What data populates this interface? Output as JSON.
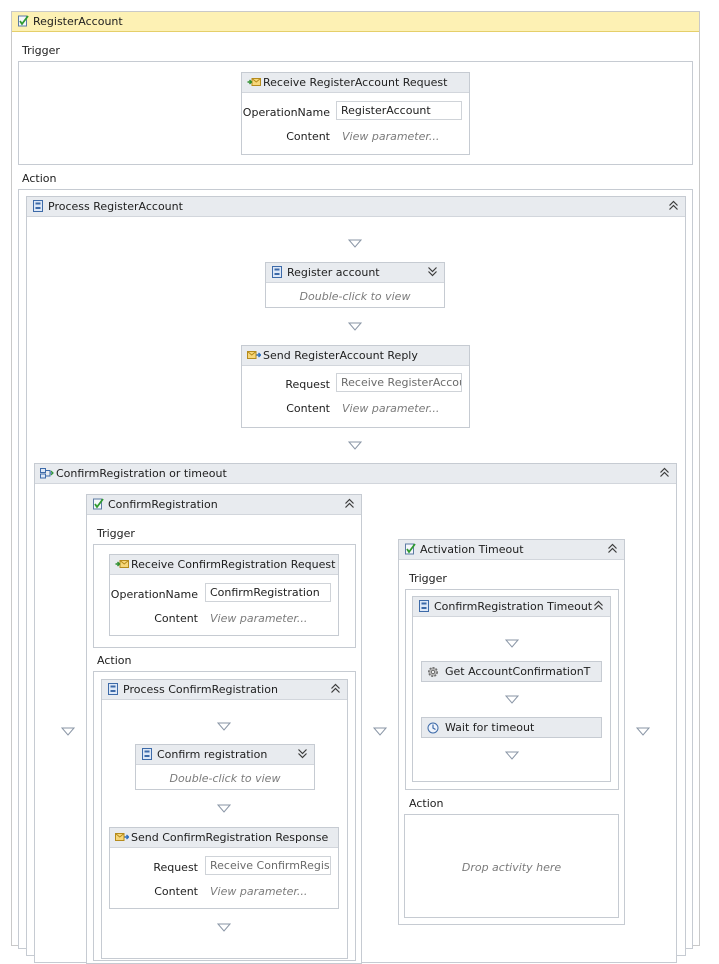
{
  "workflow": {
    "title": "RegisterAccount",
    "trigger_label": "Trigger",
    "action_label": "Action",
    "receive": {
      "title": "Receive RegisterAccount Request",
      "operation_label": "OperationName",
      "operation_value": "RegisterAccount",
      "content_label": "Content",
      "content_value": "View parameter..."
    },
    "process": {
      "title": "Process RegisterAccount",
      "register": {
        "title": "Register account",
        "body": "Double-click to view"
      },
      "send_reply": {
        "title": "Send RegisterAccount Reply",
        "request_label": "Request",
        "request_value": "Receive RegisterAccount",
        "content_label": "Content",
        "content_value": "View parameter..."
      },
      "pick": {
        "title": "ConfirmRegistration or timeout",
        "confirm_branch": {
          "title": "ConfirmRegistration",
          "trigger_label": "Trigger",
          "action_label": "Action",
          "receive": {
            "title": "Receive ConfirmRegistration Request",
            "operation_label": "OperationName",
            "operation_value": "ConfirmRegistration",
            "content_label": "Content",
            "content_value": "View parameter..."
          },
          "process": {
            "title": "Process ConfirmRegistration",
            "confirm": {
              "title": "Confirm registration",
              "body": "Double-click to view"
            },
            "send_response": {
              "title": "Send ConfirmRegistration Response",
              "request_label": "Request",
              "request_value": "Receive ConfirmRegistrat",
              "content_label": "Content",
              "content_value": "View parameter..."
            }
          }
        },
        "timeout_branch": {
          "title": "Activation Timeout",
          "trigger_label": "Trigger",
          "action_label": "Action",
          "sequence": {
            "title": "ConfirmRegistration Timeout",
            "get_activity": "Get AccountConfirmationT",
            "wait_activity": "Wait for timeout"
          },
          "drop_text": "Drop activity here"
        }
      }
    }
  },
  "colors": {
    "header_gold": "#fdf1b4",
    "header_gray": "#e8ebef",
    "border": "#c6cbd2"
  },
  "icons": [
    "workflow-check-icon",
    "receive-message-icon",
    "sequence-icon",
    "send-message-icon",
    "pick-icon",
    "gear-icon",
    "clock-icon",
    "collapse-icon",
    "expand-icon",
    "drop-arrow-icon"
  ]
}
